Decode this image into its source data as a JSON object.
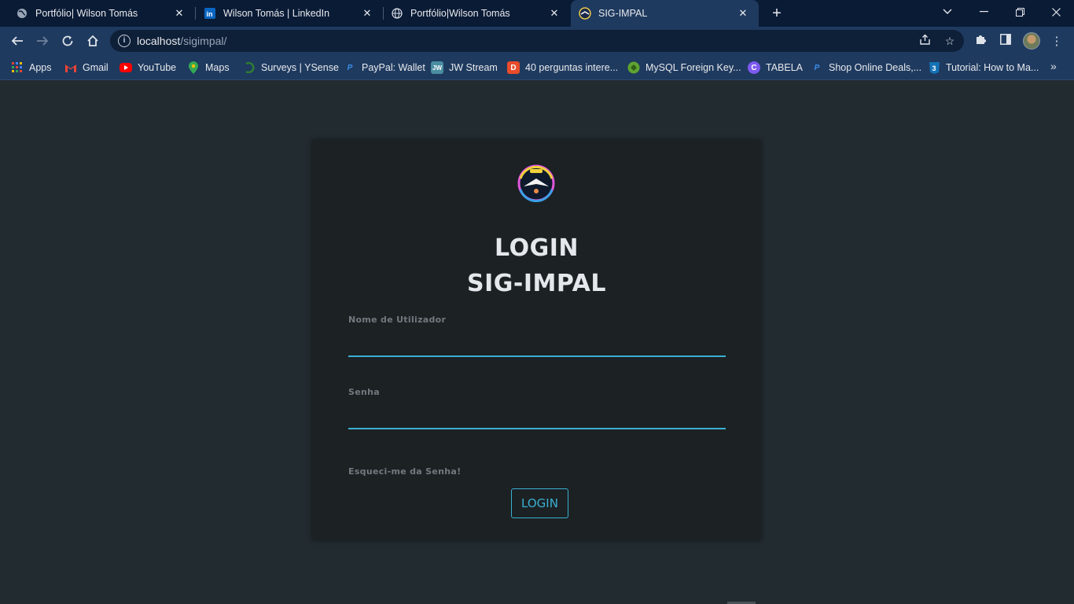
{
  "tabs": [
    {
      "title": "Portfólio| Wilson Tomás",
      "icon": "globe-icon"
    },
    {
      "title": "Wilson Tomás | LinkedIn",
      "icon": "linkedin-icon"
    },
    {
      "title": "Portfólio|Wilson Tomás",
      "icon": "globe-icon"
    },
    {
      "title": "SIG-IMPAL",
      "icon": "sigimpal-logo-icon",
      "active": true
    }
  ],
  "omnibox": {
    "host": "localhost",
    "path": "/sigimpal/"
  },
  "bookmarks": [
    {
      "label": "Apps",
      "icon": "apps-grid-icon"
    },
    {
      "label": "Gmail",
      "icon": "gmail-icon"
    },
    {
      "label": "YouTube",
      "icon": "youtube-icon"
    },
    {
      "label": "Maps",
      "icon": "maps-pin-icon"
    },
    {
      "label": "Surveys | YSense",
      "icon": "ysense-icon"
    },
    {
      "label": "PayPal: Wallet",
      "icon": "paypal-icon"
    },
    {
      "label": "JW Stream",
      "icon": "jw-stream-icon"
    },
    {
      "label": "40 perguntas intere...",
      "icon": "bookmark-d-icon"
    },
    {
      "label": "MySQL Foreign Key...",
      "icon": "mysql-icon"
    },
    {
      "label": "TABELA",
      "icon": "canva-icon"
    },
    {
      "label": "Shop Online Deals,...",
      "icon": "paypal-icon"
    },
    {
      "label": "Tutorial: How to Ma...",
      "icon": "css3-icon"
    }
  ],
  "login": {
    "title_line1": "LOGIN",
    "title_line2": "SIG-IMPAL",
    "username_label": "Nome de Utilizador",
    "username_value": "",
    "password_label": "Senha",
    "password_value": "",
    "forgot_link": "Esqueci-me da Senha!",
    "submit_label": "LOGIN"
  },
  "colors": {
    "accent": "#3ab0d2",
    "page_bg": "#222b30",
    "card_bg": "#1c2124",
    "chrome_bg": "#1f3a5f"
  }
}
